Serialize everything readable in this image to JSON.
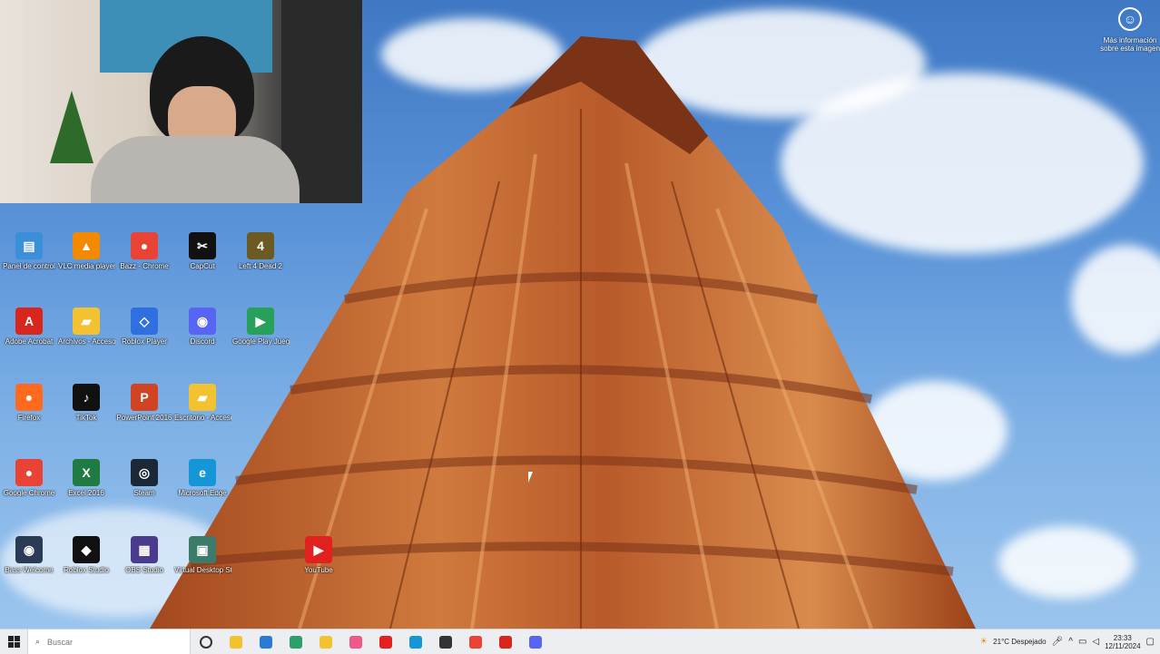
{
  "webcam": {
    "label": "webcam overlay"
  },
  "notifications": {
    "icon": "account-circle-icon",
    "text": "Más información sobre esta imagen"
  },
  "desktop_icons": [
    {
      "label": "Panel de control",
      "icon": "control-panel-icon",
      "color": "#3a8fd8",
      "glyph": "▤"
    },
    {
      "label": "VLC media player",
      "icon": "vlc-icon",
      "color": "#f18a00",
      "glyph": "▲"
    },
    {
      "label": "Bazz - Chrome",
      "icon": "chrome-icon",
      "color": "#e84335",
      "glyph": "●"
    },
    {
      "label": "CapCut",
      "icon": "capcut-icon",
      "color": "#111111",
      "glyph": "✂"
    },
    {
      "label": "Left 4 Dead 2",
      "icon": "left4dead-icon",
      "color": "#6b5a22",
      "glyph": "4"
    },
    {
      "label": "Adobe Acrobat",
      "icon": "acrobat-icon",
      "color": "#d8261f",
      "glyph": "A"
    },
    {
      "label": "Archivos - Acceso directo",
      "icon": "folder-icon",
      "color": "#f2c230",
      "glyph": "▰"
    },
    {
      "label": "Roblox Player",
      "icon": "roblox-icon",
      "color": "#2f6fe0",
      "glyph": "◇"
    },
    {
      "label": "Discord",
      "icon": "discord-icon",
      "color": "#5865f2",
      "glyph": "◉"
    },
    {
      "label": "Google Play Juegos",
      "icon": "google-play-icon",
      "color": "#27a05a",
      "glyph": "▶"
    },
    {
      "label": "Firefox",
      "icon": "firefox-icon",
      "color": "#ff6a1e",
      "glyph": "●"
    },
    {
      "label": "TikTok",
      "icon": "tiktok-icon",
      "color": "#111111",
      "glyph": "♪"
    },
    {
      "label": "PowerPoint 2016",
      "icon": "powerpoint-icon",
      "color": "#d04423",
      "glyph": "P"
    },
    {
      "label": "Escritorio - Acceso directo",
      "icon": "folder-icon",
      "color": "#f2c230",
      "glyph": "▰"
    },
    {
      "label": "Google Chrome",
      "icon": "chrome-icon",
      "color": "#e84335",
      "glyph": "●"
    },
    {
      "label": "Excel 2016",
      "icon": "excel-icon",
      "color": "#1f7a43",
      "glyph": "X"
    },
    {
      "label": "Steam",
      "icon": "steam-icon",
      "color": "#1b2838",
      "glyph": "◎"
    },
    {
      "label": "Microsoft Edge",
      "icon": "edge-icon",
      "color": "#1596d6",
      "glyph": "e"
    },
    {
      "label": "Bass Welcome",
      "icon": "welcome-icon",
      "color": "#2b3a55",
      "glyph": "◉"
    },
    {
      "label": "Roblox Studio",
      "icon": "roblox-studio-icon",
      "color": "#111111",
      "glyph": "◆"
    },
    {
      "label": "OBS Studio",
      "icon": "obs-icon",
      "color": "#4b3b8f",
      "glyph": "▦"
    },
    {
      "label": "Virtual Desktop Streamer",
      "icon": "virtual-desktop-icon",
      "color": "#3c7b6a",
      "glyph": "▣"
    },
    {
      "label": "YouTube",
      "icon": "youtube-icon",
      "color": "#e32020",
      "glyph": "▶"
    }
  ],
  "taskbar": {
    "search_placeholder": "Buscar",
    "apps": [
      {
        "icon": "task-view-icon",
        "color": "#333333"
      },
      {
        "icon": "file-explorer-icon",
        "color": "#f2c230"
      },
      {
        "icon": "mail-icon",
        "color": "#2a7ad6"
      },
      {
        "icon": "settings-icon",
        "color": "#2aa06a"
      },
      {
        "icon": "folder-icon",
        "color": "#f2c230"
      },
      {
        "icon": "copilot-icon",
        "color": "#f05a8a"
      },
      {
        "icon": "youtube-icon",
        "color": "#e32020"
      },
      {
        "icon": "edge-icon",
        "color": "#1596d6"
      },
      {
        "icon": "obs-icon",
        "color": "#333333"
      },
      {
        "icon": "chrome-icon",
        "color": "#e84335"
      },
      {
        "icon": "app-icon",
        "color": "#d8261f"
      },
      {
        "icon": "discord-icon",
        "color": "#5865f2"
      }
    ],
    "weather": "21°C Despejado",
    "time": "23:33",
    "date": "12/11/2024"
  }
}
